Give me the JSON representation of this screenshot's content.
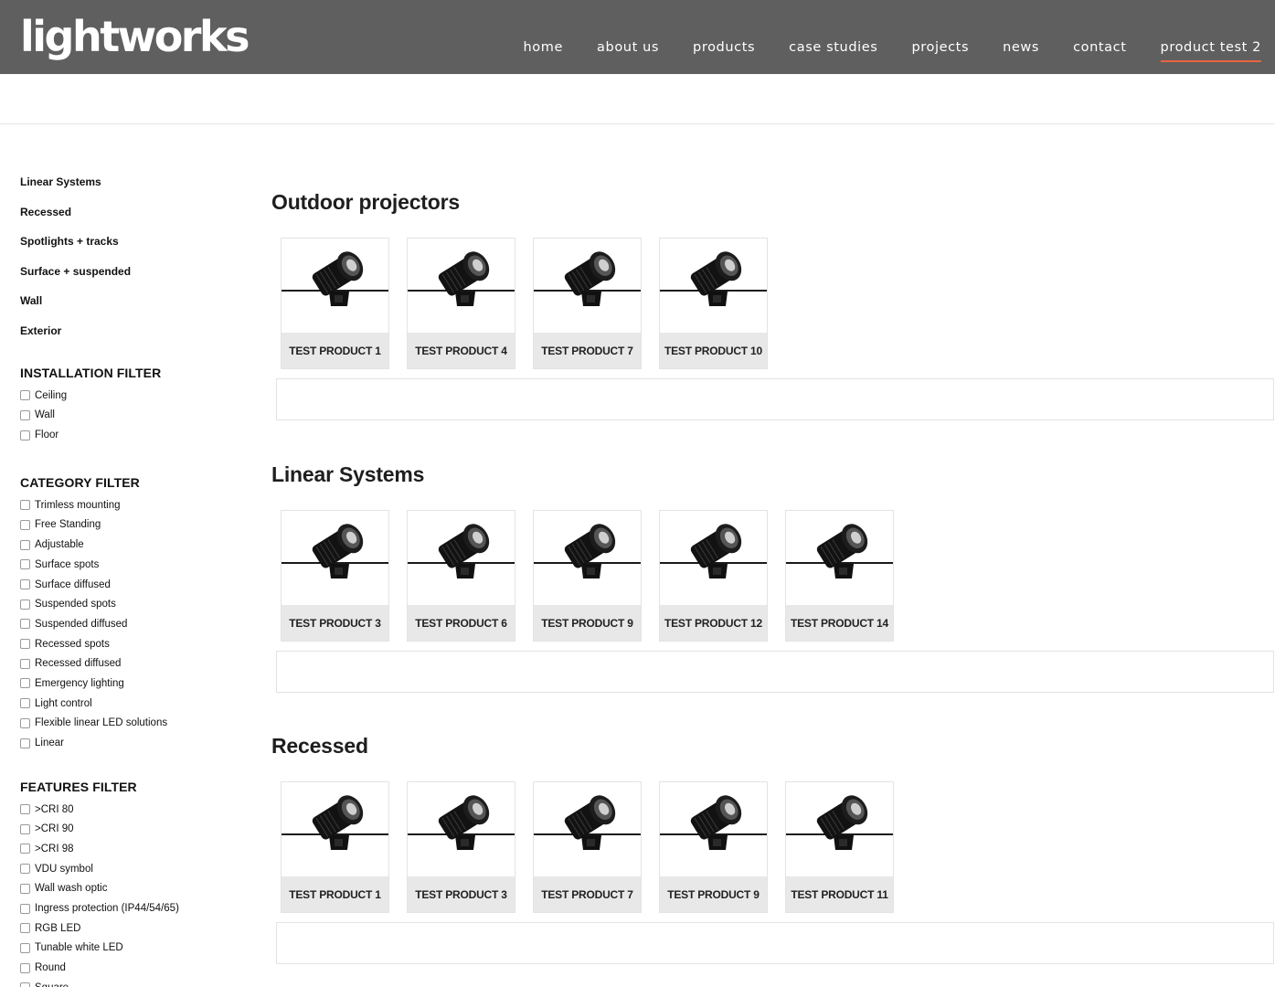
{
  "header": {
    "logo": "lightworks",
    "nav": [
      {
        "label": "home",
        "active": false
      },
      {
        "label": "about us",
        "active": false
      },
      {
        "label": "products",
        "active": false
      },
      {
        "label": "case studies",
        "active": false
      },
      {
        "label": "projects",
        "active": false
      },
      {
        "label": "news",
        "active": false
      },
      {
        "label": "contact",
        "active": false
      },
      {
        "label": "product test 2",
        "active": true
      }
    ],
    "accent_color": "#e8643c",
    "bar_color": "#5f5f5f"
  },
  "sidebar": {
    "categories": [
      "Linear Systems",
      "Recessed",
      "Spotlights + tracks",
      "Surface + suspended",
      "Wall",
      "Exterior"
    ],
    "filters": [
      {
        "title": "INSTALLATION FILTER",
        "options": [
          "Ceiling",
          "Wall",
          "Floor"
        ]
      },
      {
        "title": "CATEGORY FILTER",
        "options": [
          "Trimless mounting",
          "Free Standing",
          "Adjustable",
          "Surface spots",
          "Surface diffused",
          "Suspended spots",
          "Suspended diffused",
          "Recessed spots",
          "Recessed diffused",
          "Emergency lighting",
          "Light control",
          "Flexible linear LED solutions",
          "Linear"
        ]
      },
      {
        "title": "FEATURES FILTER",
        "options": [
          ">CRI 80",
          ">CRI 90",
          ">CRI 98",
          "VDU symbol",
          "Wall wash optic",
          "Ingress protection (IP44/54/65)",
          "RGB LED",
          "Tunable white LED",
          "Round",
          "Square"
        ]
      }
    ]
  },
  "sections": [
    {
      "title": "Outdoor projectors",
      "products": [
        "TEST PRODUCT 1",
        "TEST PRODUCT 4",
        "TEST PRODUCT 7",
        "TEST PRODUCT 10"
      ]
    },
    {
      "title": "Linear Systems",
      "products": [
        "TEST PRODUCT 3",
        "TEST PRODUCT 6",
        "TEST PRODUCT 9",
        "TEST PRODUCT 12",
        "TEST PRODUCT 14"
      ]
    },
    {
      "title": "Recessed",
      "products": [
        "TEST PRODUCT 1",
        "TEST PRODUCT 3",
        "TEST PRODUCT 7",
        "TEST PRODUCT 9",
        "TEST PRODUCT 11"
      ]
    }
  ]
}
